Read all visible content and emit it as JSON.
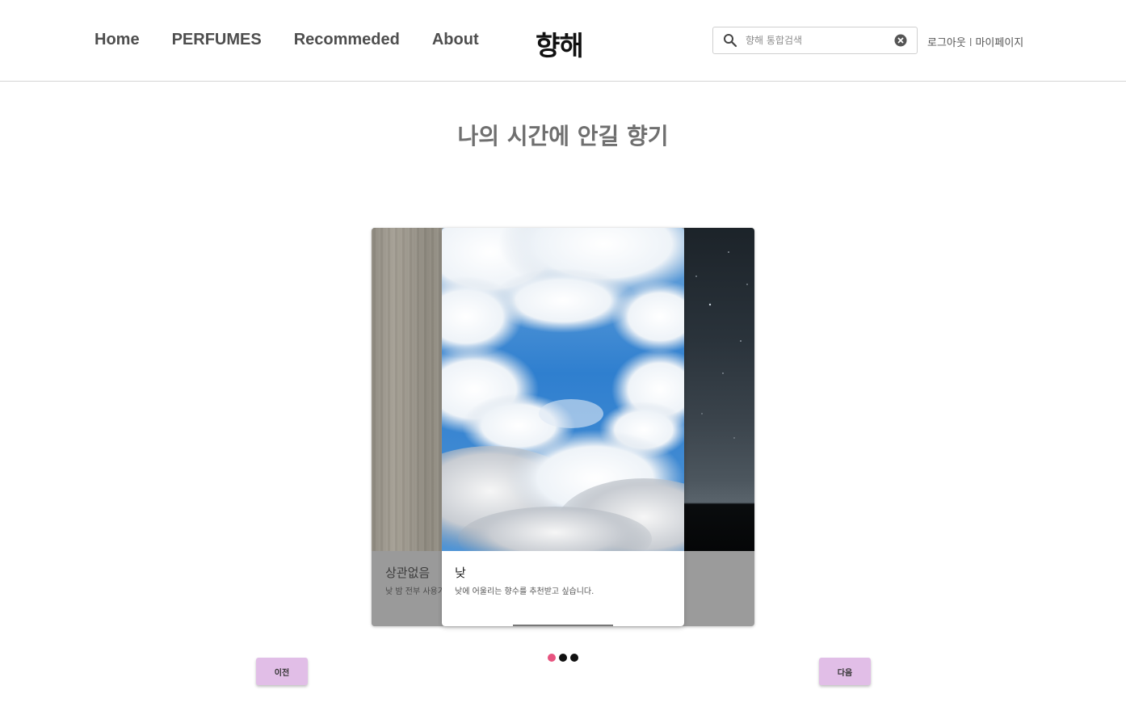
{
  "nav": {
    "items": [
      "Home",
      "PERFUMES",
      "Recommeded",
      "About"
    ]
  },
  "logo": {
    "text": "향해"
  },
  "search": {
    "placeholder": "향해 통합검색",
    "icon": "search-icon",
    "clear_icon": "close-circle-icon"
  },
  "user": {
    "logout": "로그아웃",
    "separator": "l",
    "mypage": "마이페이지"
  },
  "main": {
    "title": "나의 시간에 안길 향기"
  },
  "carousel": {
    "side_left": {
      "title": "상관없음",
      "desc": "낮 밤 전부 사용가"
    },
    "active": {
      "title": "낮",
      "desc": "낮에 어울리는 향수를 추천받고 싶습니다."
    },
    "dots": [
      {
        "color": "#e7537f",
        "active": true
      },
      {
        "color": "#111111",
        "active": false
      },
      {
        "color": "#111111",
        "active": false
      }
    ],
    "prev_label": "이전",
    "next_label": "다음"
  },
  "colors": {
    "accent_button": "#e1bee7",
    "nav_text": "#4e4e4e",
    "active_dot": "#e7537f"
  }
}
